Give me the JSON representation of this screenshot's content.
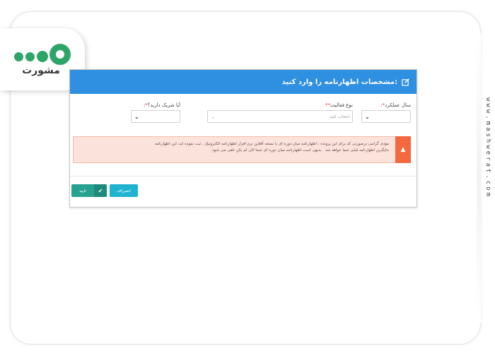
{
  "logo": {
    "wordmark": "مشورت"
  },
  "website": "www.mashwerat.com",
  "dialog": {
    "title": "مشخصات اظهارنامه را وارد کنید:",
    "fields": [
      {
        "label": "سال عملکرد",
        "required": "*",
        "value": ""
      },
      {
        "label": "نوع فعالیت",
        "required": "**",
        "placeholder": "انتخاب کنید"
      },
      {
        "label": "آیا شریک دارید؟",
        "required": "*",
        "value": ""
      }
    ],
    "alert": {
      "line1": "مؤدی گرامی درصورتی که برای این پرونده ، اظهارنامه میان دوره ای با نسخه آفلاین نرم افزار اظهارنامه الکترونیک ، ثبت نموده اید، این اظهارنامه",
      "line2": "جایگزین اظهارنامه قبلی شما خواهد شد . بدیهی است اظهارنامه میان دوره ای شما کان لم یکن تلقی می شود.",
      "color": "#f3683f"
    },
    "buttons": {
      "cancel": "انصراف",
      "confirm": "تایید"
    }
  },
  "colors": {
    "header": "#2f8fe0",
    "confirm": "#27a190",
    "cancel": "#1fb3cf",
    "brand": "#2ea567"
  }
}
